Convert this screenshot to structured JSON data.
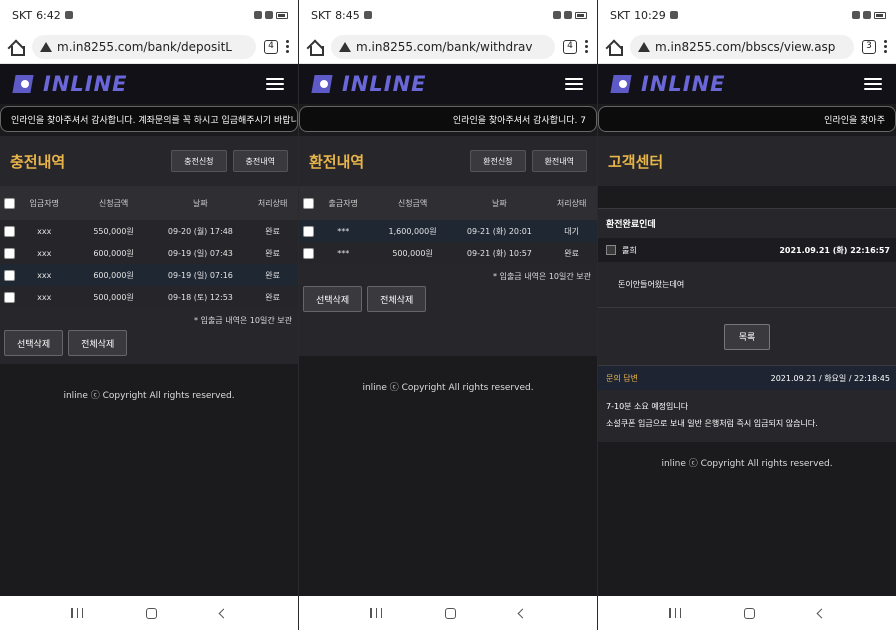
{
  "screens": [
    {
      "status": {
        "carrier": "SKT",
        "time": "6:42"
      },
      "url": "m.in8255.com/bank/depositL",
      "tab_count": "4",
      "logo_text": "INLINE",
      "marquee": "인라인을 찾아주셔서 감사합니다. 계좌문의를 꼭 하시고 입금해주시기 바랍니다",
      "title": "충전내역",
      "header_buttons": [
        "충전신청",
        "충전내역"
      ],
      "columns": [
        "입금자명",
        "신청금액",
        "날짜",
        "처리상태"
      ],
      "rows": [
        {
          "name": "xxx",
          "amount": "550,000원",
          "date": "09-20 (월) 17:48",
          "status": "완료"
        },
        {
          "name": "xxx",
          "amount": "600,000원",
          "date": "09-19 (일) 07:43",
          "status": "완료"
        },
        {
          "name": "xxx",
          "amount": "600,000원",
          "date": "09-19 (일) 07:16",
          "status": "완료"
        },
        {
          "name": "xxx",
          "amount": "500,000원",
          "date": "09-18 (토) 12:53",
          "status": "완료"
        }
      ],
      "note": "* 입출금 내역은 10일간 보관",
      "footer_buttons": [
        "선택삭제",
        "전체삭제"
      ],
      "copyright": "inline ⓒ Copyright All rights reserved."
    },
    {
      "status": {
        "carrier": "SKT",
        "time": "8:45"
      },
      "url": "m.in8255.com/bank/withdrav",
      "tab_count": "4",
      "logo_text": "INLINE",
      "marquee": "인라인을 찾아주셔서 감사합니다. 7",
      "title": "환전내역",
      "header_buttons": [
        "환전신청",
        "환전내역"
      ],
      "columns": [
        "출금자명",
        "신청금액",
        "날짜",
        "처리상태"
      ],
      "rows": [
        {
          "name": "***",
          "amount": "1,600,000원",
          "date": "09-21 (화) 20:01",
          "status": "대기"
        },
        {
          "name": "***",
          "amount": "500,000원",
          "date": "09-21 (화) 10:57",
          "status": "완료"
        }
      ],
      "note": "* 입출금 내역은 10일간 보관",
      "footer_buttons": [
        "선택삭제",
        "전체삭제"
      ],
      "copyright": "inline ⓒ Copyright All rights reserved."
    },
    {
      "status": {
        "carrier": "SKT",
        "time": "10:29"
      },
      "url": "m.in8255.com/bbscs/view.asp",
      "tab_count": "3",
      "logo_text": "INLINE",
      "marquee": "인라인을 찾아주",
      "title": "고객센터",
      "post": {
        "subject": "환전완료인데",
        "author": "룰희",
        "datetime": "2021.09.21 (화) 22:16:57",
        "body": "돈이안들어왔는데여"
      },
      "list_button": "목록",
      "answer": {
        "label": "문의 답변",
        "datetime": "2021.09.21 / 화요일 / 22:18:45",
        "lines": [
          "7-10분 소요 예정입니다",
          "소설쿠폰 입금으로 보내 일반 은행처럼 즉시 입금되지 않습니다."
        ]
      },
      "copyright": "inline ⓒ Copyright All rights reserved."
    }
  ]
}
